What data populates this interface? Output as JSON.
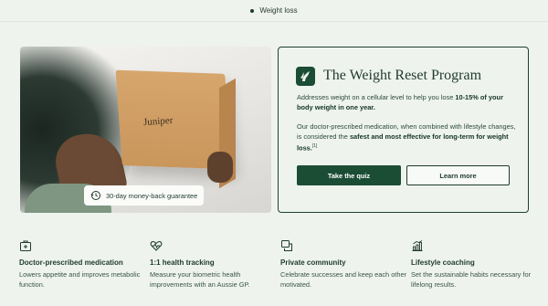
{
  "topbar": {
    "label": "Weight loss"
  },
  "hero": {
    "box_brand": "Juniper",
    "guarantee_label": "30-day money-back guarantee"
  },
  "card": {
    "title": "The Weight Reset Program",
    "p1_plain": "Addresses weight on a cellular level to help you lose ",
    "p1_bold": "10-15% of your body weight in one year.",
    "p2_plain": "Our doctor-prescribed medication, when combined with lifestyle changes, is considered the ",
    "p2_bold": "safest and most effective for long-term for weight loss.",
    "p2_sup": "[1]",
    "primary_button": "Take the quiz",
    "secondary_button": "Learn more"
  },
  "features": [
    {
      "icon": "medical-kit-icon",
      "title": "Doctor-prescribed medication",
      "desc": "Lowers appetite and improves metabolic function."
    },
    {
      "icon": "heart-pulse-icon",
      "title": "1:1 health tracking",
      "desc": "Measure your biometric health improvements with an Aussie GP."
    },
    {
      "icon": "chat-bubbles-icon",
      "title": "Private community",
      "desc": "Celebrate successes and keep each other motivated."
    },
    {
      "icon": "bar-chart-icon",
      "title": "Lifestyle coaching",
      "desc": "Set the sustainable habits necessary for lifelong results."
    }
  ],
  "colors": {
    "accent": "#1b4d34",
    "background": "#eef3ee",
    "text": "#1f3a2c"
  }
}
